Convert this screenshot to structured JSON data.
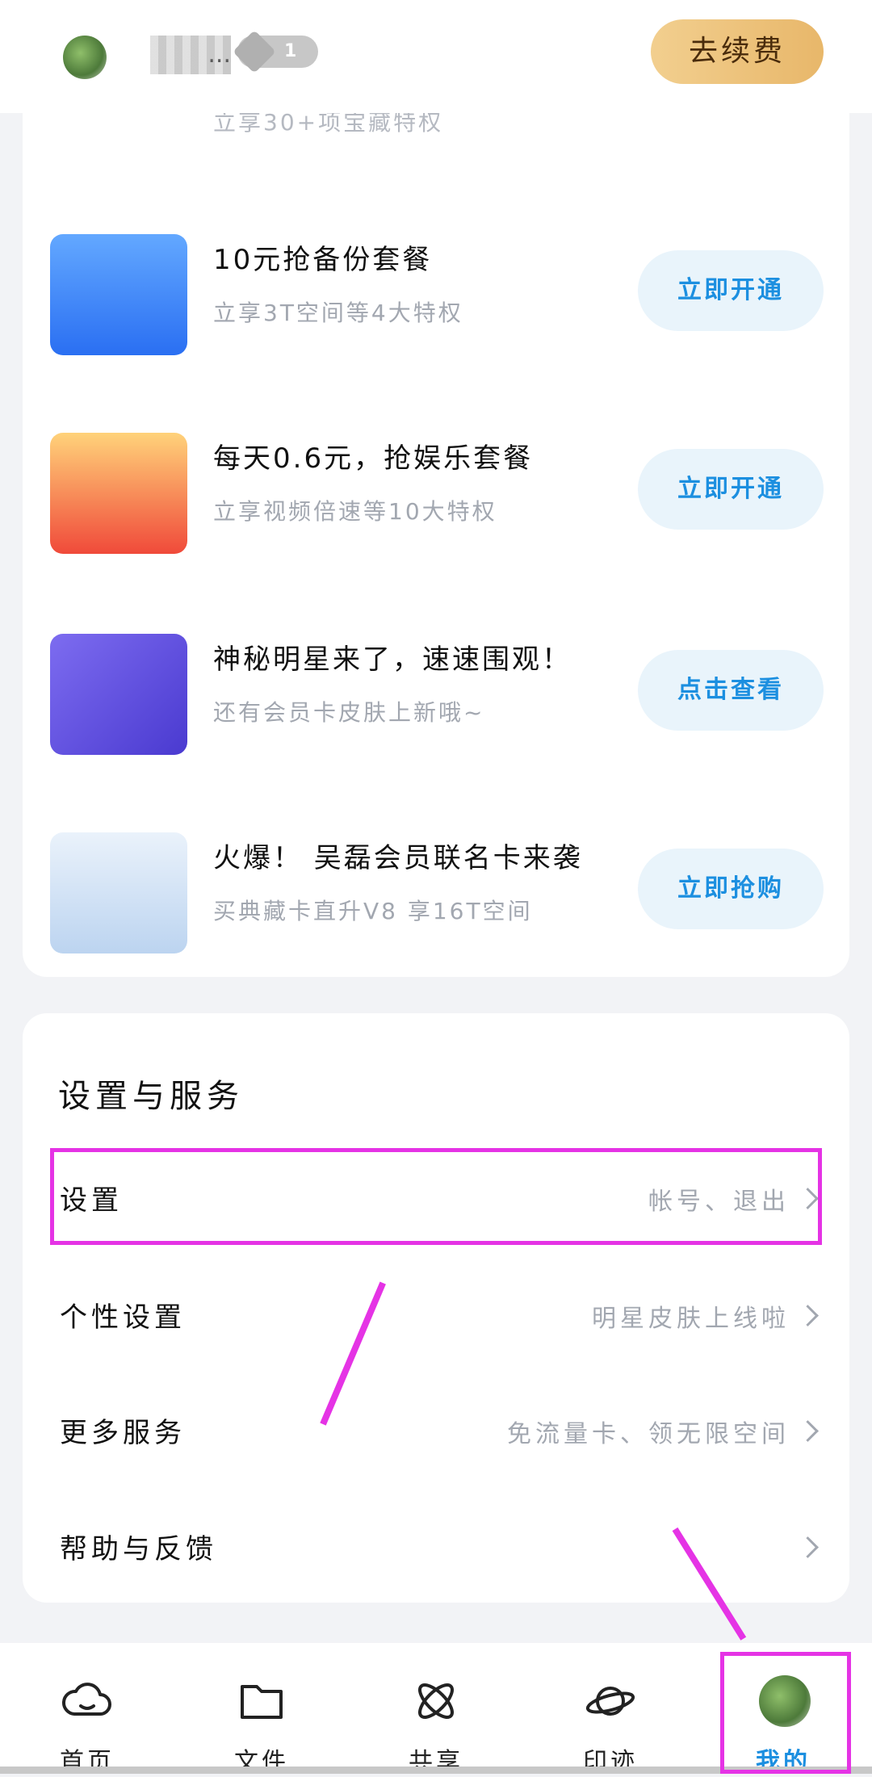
{
  "header": {
    "username": "...",
    "level": "1",
    "renew_label": "去续费"
  },
  "promo": {
    "partial_sub": "立享30+项宝藏特权",
    "items": [
      {
        "title": "10元抢备份套餐",
        "subtitle": "立享3T空间等4大特权",
        "button": "立即开通",
        "image": "backup-package-image"
      },
      {
        "title": "每天0.6元，抢娱乐套餐",
        "subtitle": "立享视频倍速等10大特权",
        "button": "立即开通",
        "image": "entertainment-package-image"
      },
      {
        "title": "神秘明星来了，速速围观！",
        "subtitle": "还有会员卡皮肤上新哦~",
        "button": "点击查看",
        "image": "member-card-image"
      },
      {
        "title": "火爆！ 吴磊会员联名卡来袭",
        "subtitle": "买典藏卡直升V8 享16T空间",
        "button": "立即抢购",
        "image": "celebrity-card-image"
      }
    ]
  },
  "settings": {
    "title": "设置与服务",
    "rows": [
      {
        "label": "设置",
        "hint": "帐号、退出"
      },
      {
        "label": "个性设置",
        "hint": "明星皮肤上线啦"
      },
      {
        "label": "更多服务",
        "hint": "免流量卡、领无限空间"
      },
      {
        "label": "帮助与反馈",
        "hint": ""
      }
    ]
  },
  "tabs": [
    {
      "label": "首页",
      "icon": "cloud-icon"
    },
    {
      "label": "文件",
      "icon": "folder-icon"
    },
    {
      "label": "共享",
      "icon": "atom-icon"
    },
    {
      "label": "印迹",
      "icon": "planet-icon"
    },
    {
      "label": "我的",
      "icon": "avatar"
    }
  ],
  "colors": {
    "accent": "#1c8fe0",
    "annotation": "#e533e5",
    "renew_gold": "#e8b76a"
  }
}
